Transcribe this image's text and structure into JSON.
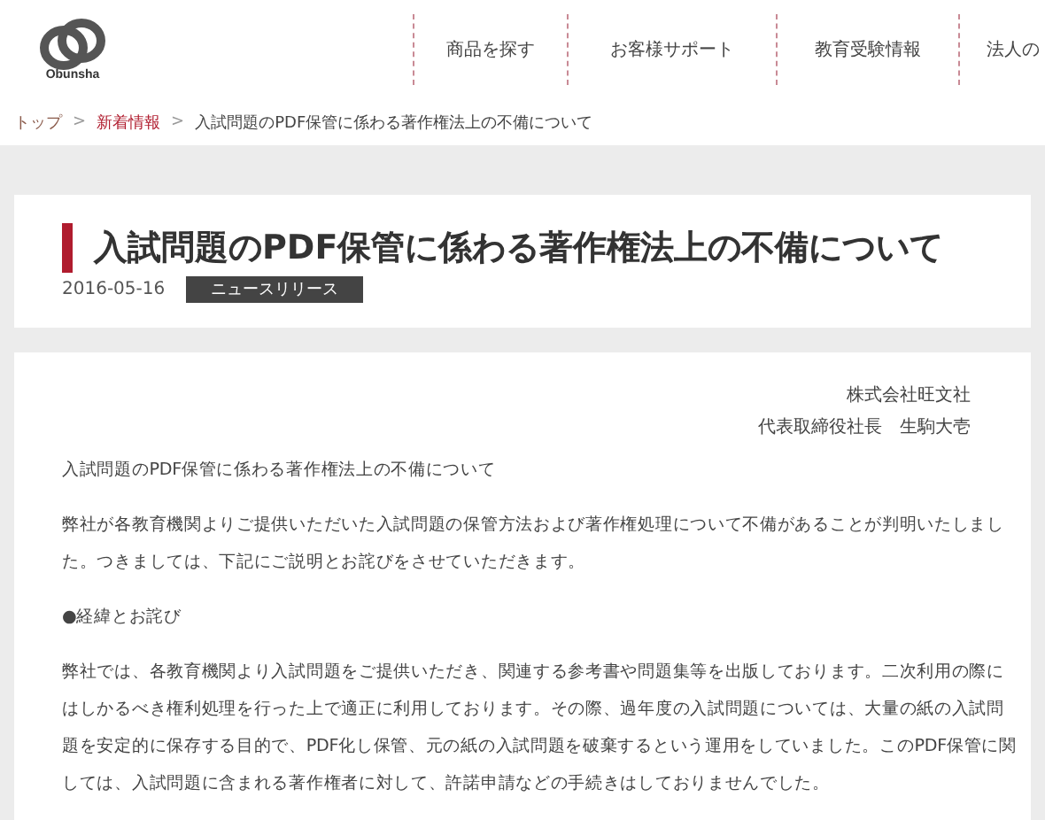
{
  "header": {
    "logo_text": "Obunsha",
    "nav": [
      {
        "label": "商品を探す"
      },
      {
        "label": "お客様サポート"
      },
      {
        "label": "教育受験情報"
      },
      {
        "label": "法人の"
      }
    ]
  },
  "breadcrumb": [
    {
      "label": "トップ",
      "kind": "link"
    },
    {
      "label": "新着情報",
      "kind": "current-section"
    },
    {
      "label": "入試問題のPDF保管に係わる著作権法上の不備について",
      "kind": "text"
    }
  ],
  "breadcrumb_separator": ">",
  "article": {
    "title": "入試問題のPDF保管に係わる著作権法上の不備について",
    "date": "2016-05-16",
    "category": "ニュースリリース",
    "signature": [
      "株式会社旺文社",
      "代表取締役社長　生駒大壱"
    ],
    "paragraphs": [
      "入試問題のPDF保管に係わる著作権法上の不備について",
      "弊社が各教育機関よりご提供いただいた入試問題の保管方法および著作権処理について不備があることが判明いたしました。つきましては、下記にご説明とお詫びをさせていただきます。",
      "●経緯とお詫び",
      "弊社では、各教育機関より入試問題をご提供いただき、関連する参考書や問題集等を出版しております。二次利用の際にはしかるべき権利処理を行った上で適正に利用しております。その際、過年度の入試問題については、大量の紙の入試問題を安定的に保存する目的で、PDF化し保管、元の紙の入試問題を破棄するという運用をしていました。このPDF保管に関しては、入試問題に含まれる著作権者に対して、許諾申請などの手続きはしておりませんでした。"
    ]
  }
}
